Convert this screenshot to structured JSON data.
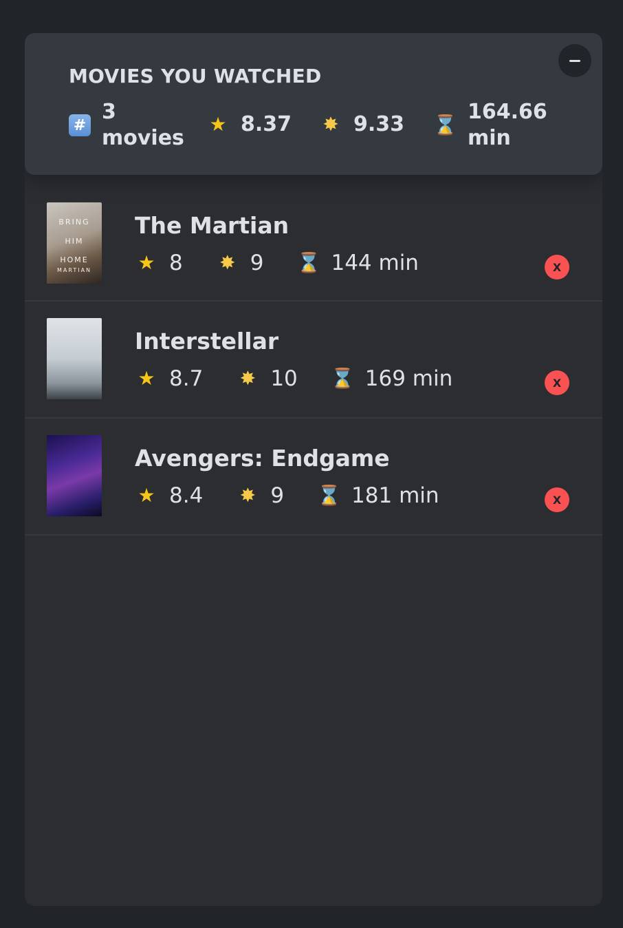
{
  "summary": {
    "title": "MOVIES YOU WATCHED",
    "toggle_label": "–",
    "count_line1": "3",
    "count_line2": "movies",
    "avg_imdb": "8.37",
    "avg_user": "9.33",
    "avg_runtime_line1": "164.66",
    "avg_runtime_line2": "min"
  },
  "movies": [
    {
      "title": "The Martian",
      "imdb": "8",
      "user": "9",
      "runtime": "144 min",
      "delete_label": "X",
      "poster_text": [
        "BRING",
        "HIM",
        "HOME",
        "MARTIAN"
      ]
    },
    {
      "title": "Interstellar",
      "imdb": "8.7",
      "user": "10",
      "runtime": "169 min",
      "delete_label": "X"
    },
    {
      "title": "Avengers: Endgame",
      "imdb": "8.4",
      "user": "9",
      "runtime": "181 min",
      "delete_label": "X"
    }
  ],
  "icons": {
    "count": "#",
    "star": "★",
    "glowing_star": "✸",
    "hourglass": "⌛"
  },
  "colors": {
    "background": "#212529",
    "panel": "#2b2d31",
    "summary": "#343a40",
    "delete": "#fa5252"
  }
}
